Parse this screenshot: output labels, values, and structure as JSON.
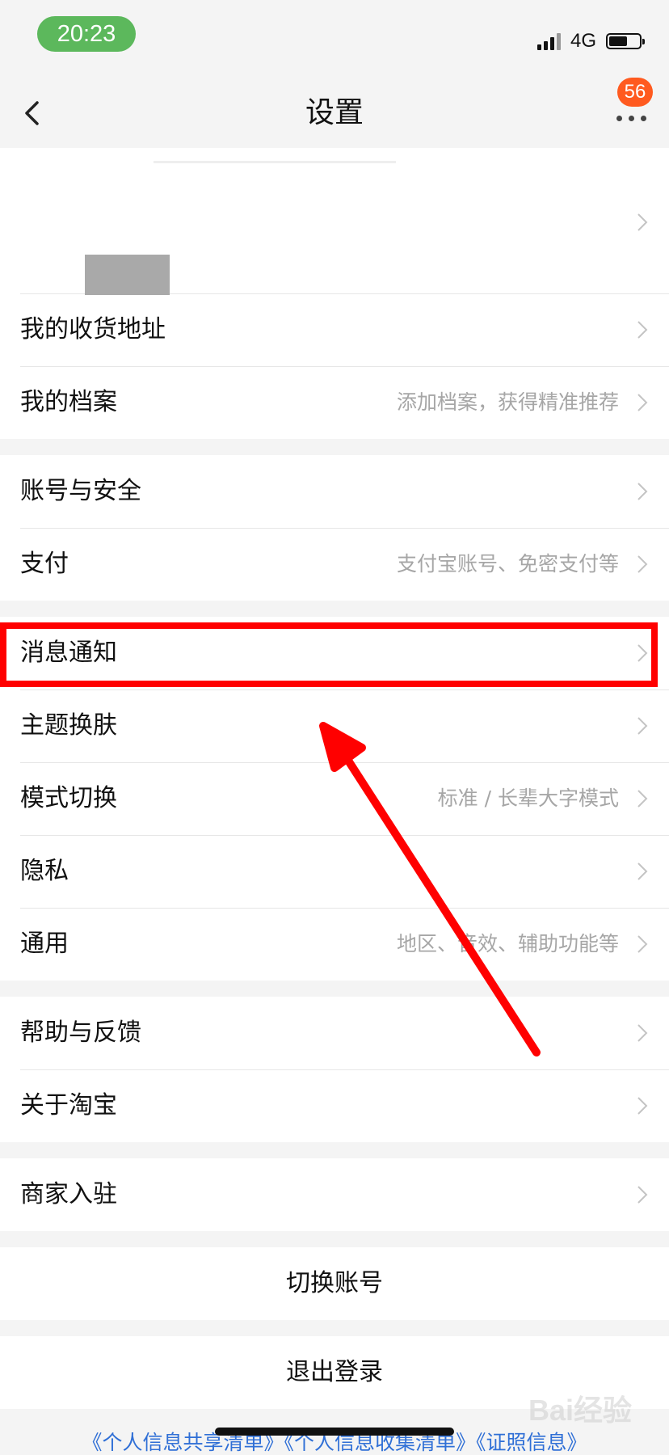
{
  "status_bar": {
    "time": "20:23",
    "network": "4G"
  },
  "nav": {
    "title": "设置",
    "badge_count": "56"
  },
  "list": {
    "address": {
      "label": "我的收货地址"
    },
    "profile": {
      "label": "我的档案",
      "hint": "添加档案，获得精准推荐"
    },
    "account_security": {
      "label": "账号与安全"
    },
    "payment": {
      "label": "支付",
      "hint": "支付宝账号、免密支付等"
    },
    "notifications": {
      "label": "消息通知"
    },
    "theme": {
      "label": "主题换肤"
    },
    "mode": {
      "label": "模式切换",
      "hint": "标准 / 长辈大字模式"
    },
    "privacy": {
      "label": "隐私"
    },
    "general": {
      "label": "通用",
      "hint": "地区、音效、辅助功能等"
    },
    "help": {
      "label": "帮助与反馈"
    },
    "about": {
      "label": "关于淘宝"
    },
    "merchant": {
      "label": "商家入驻"
    }
  },
  "actions": {
    "switch_account": "切换账号",
    "logout": "退出登录"
  },
  "footer": {
    "links": "《个人信息共享清单》《个人信息收集清单》《证照信息》"
  },
  "watermark": {
    "text": "Bai经验"
  },
  "colors": {
    "accent_badge": "#ff5a1f",
    "highlight": "#ff0000",
    "time_pill": "#5cb85c",
    "link": "#2f6fd6"
  }
}
